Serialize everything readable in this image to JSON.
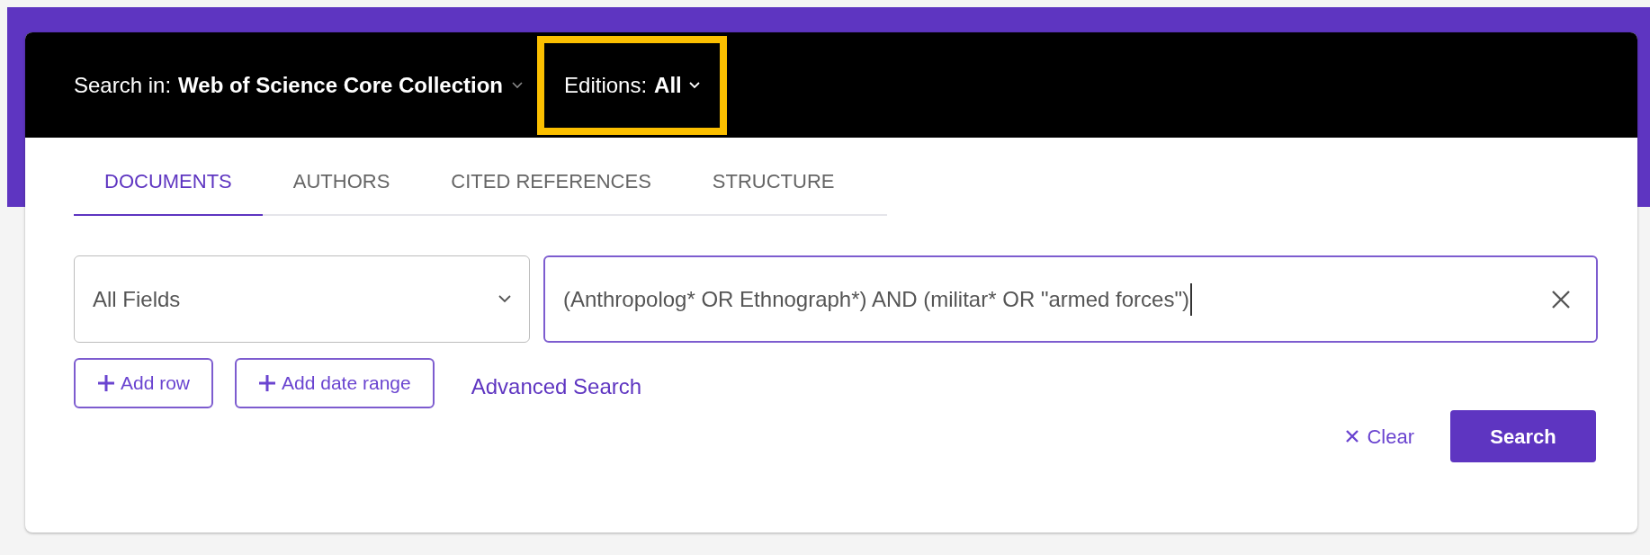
{
  "header": {
    "search_in_label": "Search in:",
    "search_in_value": "Web of Science Core Collection",
    "editions_label": "Editions:",
    "editions_value": "All",
    "editions_highlighted": true
  },
  "tabs": [
    {
      "label": "DOCUMENTS",
      "selected": true
    },
    {
      "label": "AUTHORS",
      "selected": false
    },
    {
      "label": "CITED REFERENCES",
      "selected": false
    },
    {
      "label": "STRUCTURE",
      "selected": false
    }
  ],
  "field_select": {
    "value": "All Fields"
  },
  "query": {
    "value": "(Anthropolog* OR Ethnograph*) AND (militar* OR \"armed forces\")"
  },
  "row_buttons": [
    "Add row",
    "Add date range"
  ],
  "advanced_link": "Advanced Search",
  "clear_button": "Clear",
  "search_button": "Search"
}
